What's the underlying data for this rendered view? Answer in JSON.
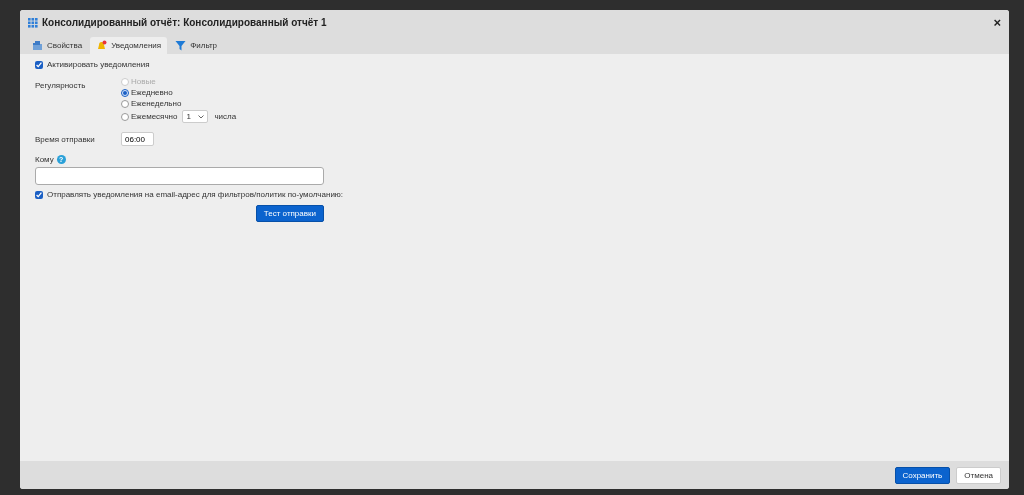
{
  "dialog": {
    "title": "Консолидированный отчёт: Консолидированный отчёт 1",
    "close": "×"
  },
  "tabs": [
    {
      "label": "Свойства",
      "kind": "properties",
      "selected": false
    },
    {
      "label": "Уведомления",
      "kind": "notifications",
      "selected": true
    },
    {
      "label": "Фильтр",
      "kind": "filter",
      "selected": false
    }
  ],
  "activate": {
    "label": "Активировать уведомления",
    "checked": true
  },
  "frequency": {
    "label": "Регулярность",
    "options": [
      {
        "label": "Новые",
        "selected": false,
        "disabled": true
      },
      {
        "label": "Ежедневно",
        "selected": true,
        "disabled": false
      },
      {
        "label": "Еженедельно",
        "selected": false,
        "disabled": false
      },
      {
        "label": "Ежемесячно",
        "selected": false,
        "disabled": false,
        "day": "1",
        "suffix": "числа"
      }
    ]
  },
  "send_time": {
    "label": "Время отправки",
    "value": "06:00"
  },
  "recipients": {
    "label": "Кому",
    "help": "?"
  },
  "default_email": {
    "label": "Отправлять уведомления на email-адрес для фильтров/политик по-умолчанию:",
    "checked": true
  },
  "test_button": "Тест отправки",
  "footer_buttons": [
    {
      "label": "Сохранить",
      "kind": "primary"
    },
    {
      "label": "Отмена",
      "kind": "secondary"
    }
  ]
}
